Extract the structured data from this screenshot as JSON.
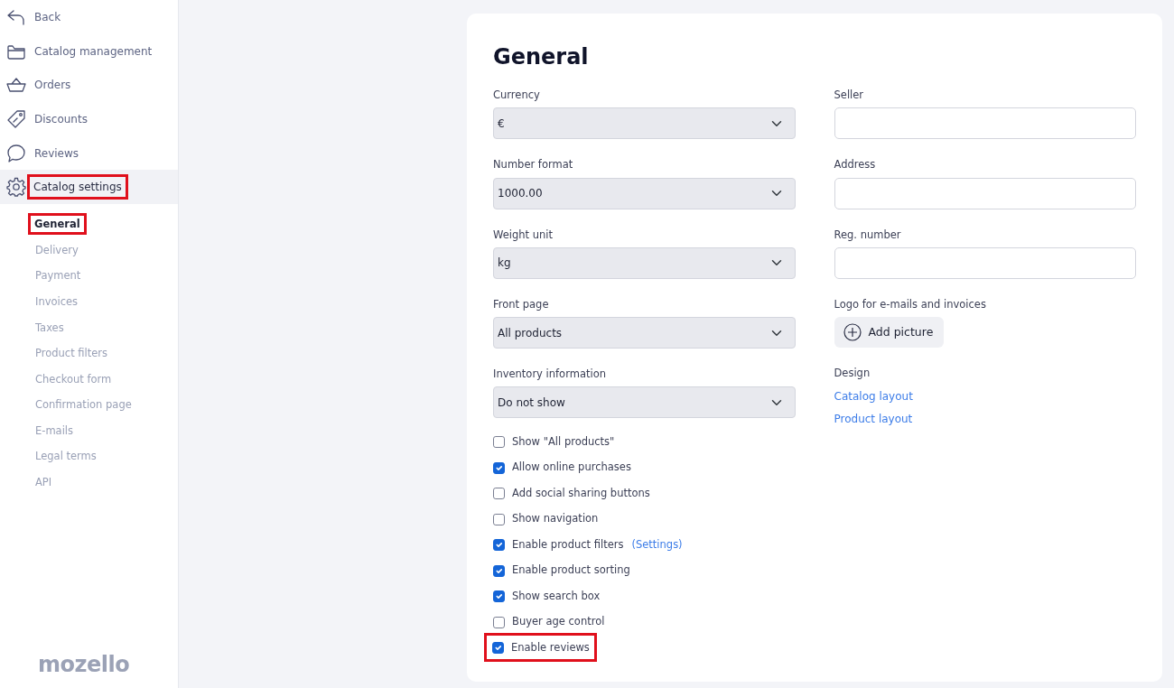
{
  "sidebar": {
    "items": [
      {
        "label": "Back",
        "selected": false,
        "highlighted": false
      },
      {
        "label": "Catalog management",
        "selected": false,
        "highlighted": false
      },
      {
        "label": "Orders",
        "selected": false,
        "highlighted": false
      },
      {
        "label": "Discounts",
        "selected": false,
        "highlighted": false
      },
      {
        "label": "Reviews",
        "selected": false,
        "highlighted": false
      },
      {
        "label": "Catalog settings",
        "selected": true,
        "highlighted": true
      }
    ],
    "subitems": [
      {
        "label": "General",
        "selected": true,
        "highlighted": true
      },
      {
        "label": "Delivery",
        "selected": false,
        "highlighted": false
      },
      {
        "label": "Payment",
        "selected": false,
        "highlighted": false
      },
      {
        "label": "Invoices",
        "selected": false,
        "highlighted": false
      },
      {
        "label": "Taxes",
        "selected": false,
        "highlighted": false
      },
      {
        "label": "Product filters",
        "selected": false,
        "highlighted": false
      },
      {
        "label": "Checkout form",
        "selected": false,
        "highlighted": false
      },
      {
        "label": "Confirmation page",
        "selected": false,
        "highlighted": false
      },
      {
        "label": "E-mails",
        "selected": false,
        "highlighted": false
      },
      {
        "label": "Legal terms",
        "selected": false,
        "highlighted": false
      },
      {
        "label": "API",
        "selected": false,
        "highlighted": false
      }
    ],
    "logo": "mozello"
  },
  "page_title": "General",
  "selects": [
    {
      "label": "Currency",
      "value": "€"
    },
    {
      "label": "Number format",
      "value": "1000.00"
    },
    {
      "label": "Weight unit",
      "value": "kg"
    },
    {
      "label": "Front page",
      "value": "All products"
    },
    {
      "label": "Inventory information",
      "value": "Do not show"
    }
  ],
  "checkboxes": [
    {
      "label": "Show \"All products\"",
      "checked": false,
      "highlighted": false
    },
    {
      "label": "Allow online purchases",
      "checked": true,
      "highlighted": false
    },
    {
      "label": "Add social sharing buttons",
      "checked": false,
      "highlighted": false
    },
    {
      "label": "Show navigation",
      "checked": false,
      "highlighted": false
    },
    {
      "label": "Enable product filters",
      "link": "(Settings)",
      "checked": true,
      "highlighted": false
    },
    {
      "label": "Enable product sorting",
      "checked": true,
      "highlighted": false
    },
    {
      "label": "Show search box",
      "checked": true,
      "highlighted": false
    },
    {
      "label": "Buyer age control",
      "checked": false,
      "highlighted": false
    },
    {
      "label": "Enable reviews",
      "checked": true,
      "highlighted": true
    }
  ],
  "fields": [
    {
      "label": "Seller"
    },
    {
      "label": "Address"
    },
    {
      "label": "Reg. number"
    }
  ],
  "logo_section": {
    "label": "Logo for e-mails and invoices",
    "button": "Add picture"
  },
  "design": {
    "label": "Design",
    "links": [
      "Catalog layout",
      "Product layout"
    ]
  }
}
